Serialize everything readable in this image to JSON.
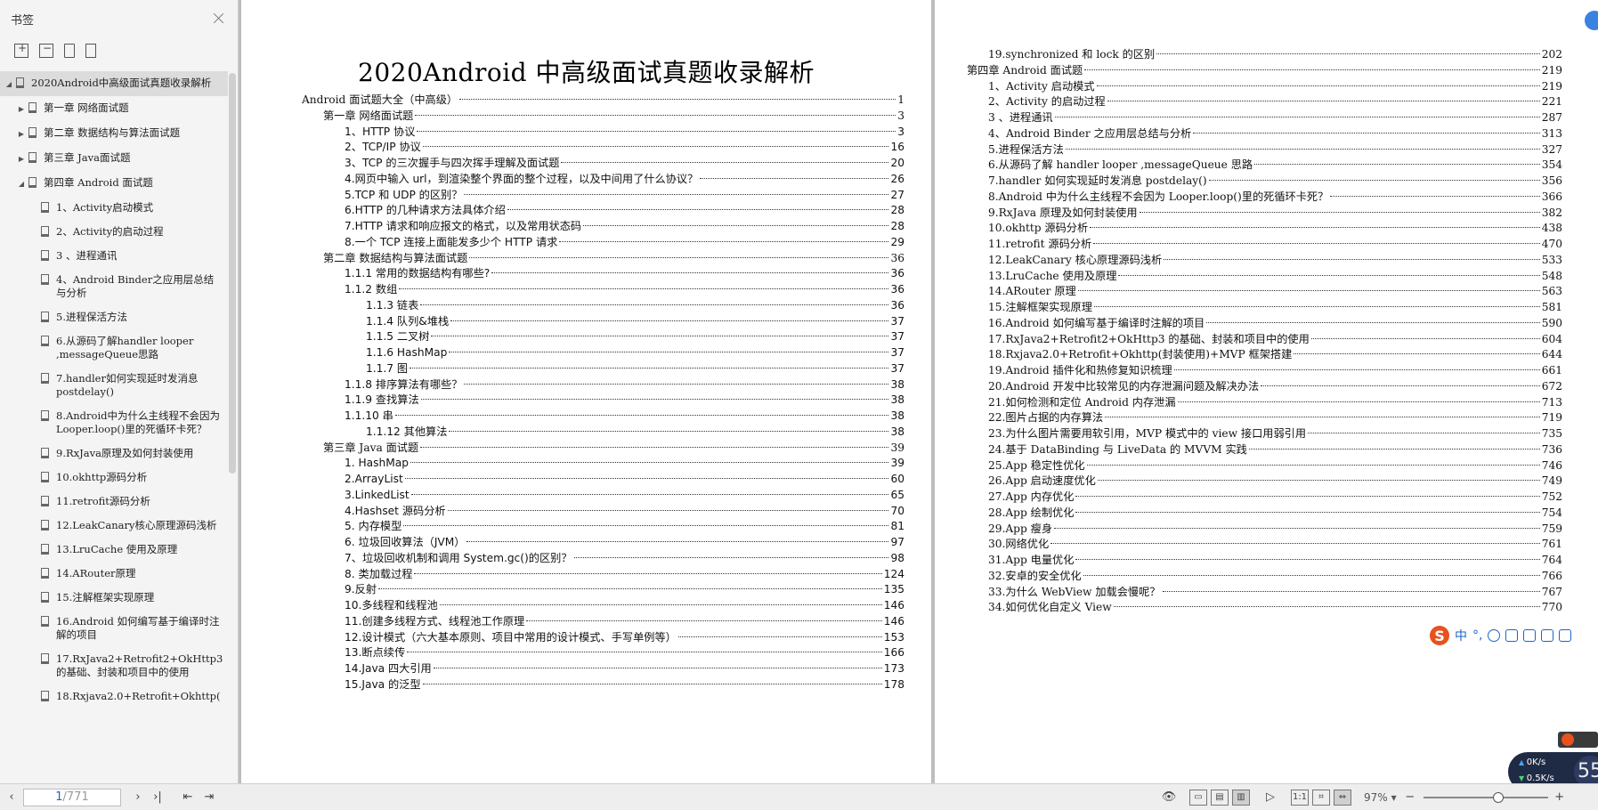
{
  "sidebar": {
    "title": "书签",
    "items": [
      {
        "label": "2020Android中高级面试真题收录解析",
        "level": 0,
        "expanded": true,
        "selected": true
      },
      {
        "label": "第一章 网络面试题",
        "level": 1,
        "expandable": true
      },
      {
        "label": "第二章 数据结构与算法面试题",
        "level": 1,
        "expandable": true
      },
      {
        "label": "第三章 Java面试题",
        "level": 1,
        "expandable": true
      },
      {
        "label": "第四章 Android 面试题",
        "level": 1,
        "expanded": true
      },
      {
        "label": "1、Activity启动模式",
        "level": 2
      },
      {
        "label": "2、Activity的启动过程",
        "level": 2
      },
      {
        "label": "3 、进程通讯",
        "level": 2
      },
      {
        "label": "4、Android Binder之应用层总结与分析",
        "level": 2
      },
      {
        "label": "5.进程保活方法",
        "level": 2
      },
      {
        "label": "6.从源码了解handler looper ,messageQueue思路",
        "level": 2
      },
      {
        "label": "7.handler如何实现延时发消息postdelay()",
        "level": 2
      },
      {
        "label": "8.Android中为什么主线程不会因为Looper.loop()里的死循环卡死？",
        "level": 2
      },
      {
        "label": "9.RxJava原理及如何封装使用",
        "level": 2
      },
      {
        "label": "10.okhttp源码分析",
        "level": 2
      },
      {
        "label": "11.retrofit源码分析",
        "level": 2
      },
      {
        "label": "12.LeakCanary核心原理源码浅析",
        "level": 2
      },
      {
        "label": "13.LruCache 使用及原理",
        "level": 2
      },
      {
        "label": "14.ARouter原理",
        "level": 2
      },
      {
        "label": "15.注解框架实现原理",
        "level": 2
      },
      {
        "label": "16.Android 如何编写基于编译时注解的项目",
        "level": 2
      },
      {
        "label": "17.RxJava2+Retrofit2+OkHttp3的基础、封装和项目中的使用",
        "level": 2
      },
      {
        "label": "18.Rxjava2.0+Retrofit+Okhttp(",
        "level": 2
      }
    ]
  },
  "document": {
    "title": "2020Android 中高级面试真题收录解析",
    "left_toc": [
      {
        "text": "Android 面试题大全（中高级）",
        "page": "1",
        "indent": 0
      },
      {
        "text": "第一章  网络面试题",
        "page": "3",
        "indent": 1
      },
      {
        "text": "1、HTTP 协议",
        "page": "3",
        "indent": 2
      },
      {
        "text": "2、TCP/IP 协议",
        "page": "16",
        "indent": 2
      },
      {
        "text": "3、TCP 的三次握手与四次挥手理解及面试题",
        "page": "20",
        "indent": 2
      },
      {
        "text": "4.网页中输入 url，到渲染整个界面的整个过程，以及中间用了什么协议？",
        "page": "26",
        "indent": 2
      },
      {
        "text": "5.TCP 和 UDP 的区别？",
        "page": "27",
        "indent": 2
      },
      {
        "text": "6.HTTP 的几种请求方法具体介绍",
        "page": "28",
        "indent": 2
      },
      {
        "text": "7.HTTP 请求和响应报文的格式，以及常用状态码",
        "page": "28",
        "indent": 2
      },
      {
        "text": "8.一个  TCP  连接上面能发多少个  HTTP  请求",
        "page": "29",
        "indent": 2
      },
      {
        "text": "第二章  数据结构与算法面试题",
        "page": "36",
        "indent": 1
      },
      {
        "text": "1.1.1  常用的数据结构有哪些?",
        "page": "36",
        "indent": 2
      },
      {
        "text": "1.1.2  数组",
        "page": "36",
        "indent": 2
      },
      {
        "text": "1.1.3  链表",
        "page": "36",
        "indent": 3
      },
      {
        "text": "1.1.4  队列&堆栈",
        "page": "37",
        "indent": 3
      },
      {
        "text": "1.1.5  二叉树",
        "page": "37",
        "indent": 3
      },
      {
        "text": "1.1.6 HashMap",
        "page": "37",
        "indent": 3
      },
      {
        "text": "1.1.7 图",
        "page": "37",
        "indent": 3
      },
      {
        "text": "1.1.8 排序算法有哪些？",
        "page": "38",
        "indent": 2
      },
      {
        "text": "1.1.9  查找算法",
        "page": "38",
        "indent": 2
      },
      {
        "text": "1.1.10  串",
        "page": "38",
        "indent": 2
      },
      {
        "text": "1.1.12  其他算法",
        "page": "38",
        "indent": 3
      },
      {
        "text": "第三章  Java 面试题",
        "page": "39",
        "indent": 1
      },
      {
        "text": "1. HashMap",
        "page": "39",
        "indent": 2
      },
      {
        "text": "2.ArrayList",
        "page": "60",
        "indent": 2
      },
      {
        "text": "3.LinkedList",
        "page": "65",
        "indent": 2
      },
      {
        "text": "4.Hashset 源码分析",
        "page": "70",
        "indent": 2
      },
      {
        "text": "5.  内存模型",
        "page": "81",
        "indent": 2
      },
      {
        "text": "6.  垃圾回收算法（JVM）",
        "page": "97",
        "indent": 2
      },
      {
        "text": "7、垃圾回收机制和调用  System.gc()的区别？",
        "page": "98",
        "indent": 2
      },
      {
        "text": "8.  类加载过程",
        "page": "124",
        "indent": 2
      },
      {
        "text": "9.反射",
        "page": "135",
        "indent": 2
      },
      {
        "text": "10.多线程和线程池",
        "page": "146",
        "indent": 2
      },
      {
        "text": "11.创建多线程方式、线程池工作原理",
        "page": "146",
        "indent": 2
      },
      {
        "text": "12.设计模式（六大基本原则、项目中常用的设计模式、手写单例等）",
        "page": "153",
        "indent": 2
      },
      {
        "text": "13.断点续传",
        "page": "166",
        "indent": 2
      },
      {
        "text": "14.Java  四大引用",
        "page": "173",
        "indent": 2
      },
      {
        "text": "15.Java  的泛型",
        "page": "178",
        "indent": 2
      }
    ],
    "right_toc": [
      {
        "text": "19.synchronized 和 lock 的区别",
        "page": "202",
        "indent": 1
      },
      {
        "text": "第四章  Android  面试题",
        "page": "219",
        "indent": 0
      },
      {
        "text": "1、Activity 启动模式",
        "page": "219",
        "indent": 1
      },
      {
        "text": "2、Activity 的启动过程",
        "page": "221",
        "indent": 1
      },
      {
        "text": "3  、进程通讯",
        "page": "287",
        "indent": 1
      },
      {
        "text": "4、Android Binder 之应用层总结与分析",
        "page": "313",
        "indent": 1
      },
      {
        "text": "5.进程保活方法",
        "page": "327",
        "indent": 1
      },
      {
        "text": "6.从源码了解 handler looper ,messageQueue 思路",
        "page": "354",
        "indent": 1
      },
      {
        "text": "7.handler 如何实现延时发消息 postdelay()",
        "page": "356",
        "indent": 1
      },
      {
        "text": "8.Android 中为什么主线程不会因为 Looper.loop()里的死循环卡死？",
        "page": "366",
        "indent": 1
      },
      {
        "text": "9.RxJava 原理及如何封装使用",
        "page": "382",
        "indent": 1
      },
      {
        "text": "10.okhttp 源码分析",
        "page": "438",
        "indent": 1
      },
      {
        "text": "11.retrofit 源码分析",
        "page": "470",
        "indent": 1
      },
      {
        "text": "12.LeakCanary 核心原理源码浅析",
        "page": "533",
        "indent": 1
      },
      {
        "text": "13.LruCache  使用及原理",
        "page": "548",
        "indent": 1
      },
      {
        "text": "14.ARouter 原理",
        "page": "563",
        "indent": 1
      },
      {
        "text": "15.注解框架实现原理",
        "page": "581",
        "indent": 1
      },
      {
        "text": "16.Android  如何编写基于编译时注解的项目",
        "page": "590",
        "indent": 1
      },
      {
        "text": "17.RxJava2+Retrofit2+OkHttp3 的基础、封装和项目中的使用",
        "page": "604",
        "indent": 1
      },
      {
        "text": "18.Rxjava2.0+Retrofit+Okhttp(封装使用)+MVP 框架搭建",
        "page": "644",
        "indent": 1
      },
      {
        "text": "19.Android  插件化和热修复知识梳理",
        "page": "661",
        "indent": 1
      },
      {
        "text": "20.Android 开发中比较常见的内存泄漏问题及解决办法",
        "page": "672",
        "indent": 1
      },
      {
        "text": "21.如何检测和定位 Android 内存泄漏",
        "page": "713",
        "indent": 1
      },
      {
        "text": "22.图片占据的内存算法",
        "page": "719",
        "indent": 1
      },
      {
        "text": "23.为什么图片需要用软引用，MVP 模式中的 view 接口用弱引用",
        "page": "735",
        "indent": 1
      },
      {
        "text": "24.基于 DataBinding 与 LiveData 的 MVVM 实践",
        "page": "736",
        "indent": 1
      },
      {
        "text": "25.App 稳定性优化",
        "page": "746",
        "indent": 1
      },
      {
        "text": "26.App 启动速度优化",
        "page": "749",
        "indent": 1
      },
      {
        "text": "27.App 内存优化",
        "page": "752",
        "indent": 1
      },
      {
        "text": "28.App 绘制优化",
        "page": "754",
        "indent": 1
      },
      {
        "text": "29.App 瘦身",
        "page": "759",
        "indent": 1
      },
      {
        "text": "30.网络优化",
        "page": "761",
        "indent": 1
      },
      {
        "text": "31.App 电量优化",
        "page": "764",
        "indent": 1
      },
      {
        "text": "32.安卓的安全优化",
        "page": "766",
        "indent": 1
      },
      {
        "text": "33.为什么 WebView 加载会慢呢？",
        "page": "767",
        "indent": 1
      },
      {
        "text": "34.如何优化自定义 View",
        "page": "770",
        "indent": 1
      }
    ]
  },
  "ime": {
    "mode": "中"
  },
  "speed_widget": {
    "up": "0K/s",
    "down": "0.5K/s",
    "value": "55"
  },
  "statusbar": {
    "current_page": "1",
    "total_pages": "/771",
    "zoom": "97%",
    "zoom_fraction": 0.6
  }
}
